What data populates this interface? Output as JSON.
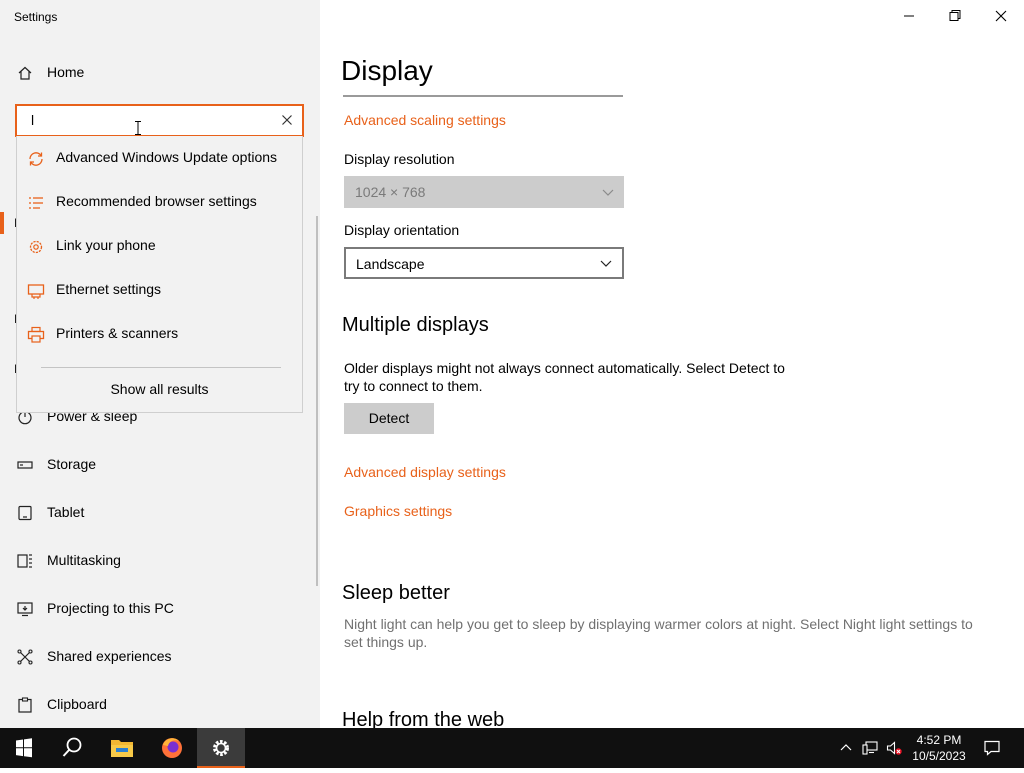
{
  "app": {
    "title": "Settings"
  },
  "sidebar": {
    "home_label": "Home",
    "ghost_letters": [
      "I",
      "I",
      "I"
    ],
    "items": [
      {
        "label": "Power & sleep",
        "icon": "power-icon"
      },
      {
        "label": "Storage",
        "icon": "storage-icon"
      },
      {
        "label": "Tablet",
        "icon": "tablet-icon"
      },
      {
        "label": "Multitasking",
        "icon": "multitasking-icon"
      },
      {
        "label": "Projecting to this PC",
        "icon": "projecting-icon"
      },
      {
        "label": "Shared experiences",
        "icon": "shared-experiences-icon"
      },
      {
        "label": "Clipboard",
        "icon": "clipboard-icon"
      }
    ]
  },
  "search": {
    "value": "l",
    "suggestions": [
      {
        "label": "Advanced Windows Update options",
        "icon": "sync-icon"
      },
      {
        "label": "Recommended browser settings",
        "icon": "list-icon"
      },
      {
        "label": "Link your phone",
        "icon": "gear-icon"
      },
      {
        "label": "Ethernet settings",
        "icon": "ethernet-icon"
      },
      {
        "label": "Printers & scanners",
        "icon": "printer-icon"
      }
    ],
    "show_all": "Show all results"
  },
  "main": {
    "title": "Display",
    "advanced_scaling_link": "Advanced scaling settings",
    "resolution": {
      "label": "Display resolution",
      "value": "1024 × 768",
      "disabled": true
    },
    "orientation": {
      "label": "Display orientation",
      "value": "Landscape"
    },
    "multiple_displays": {
      "heading": "Multiple displays",
      "description": "Older displays might not always connect automatically. Select Detect to try to connect to them.",
      "detect_button": "Detect"
    },
    "advanced_display_link": "Advanced display settings",
    "graphics_link": "Graphics settings",
    "sleep_better": {
      "heading": "Sleep better",
      "description": "Night light can help you get to sleep by displaying warmer colors at night. Select Night light settings to set things up."
    },
    "help_heading": "Help from the web"
  },
  "taskbar": {
    "time": "4:52 PM",
    "date": "10/5/2023",
    "apps": [
      "start-icon",
      "search-icon",
      "file-explorer-icon",
      "firefox-icon",
      "settings-icon"
    ],
    "tray": [
      "chevron-up-icon",
      "network-icon",
      "volume-muted-icon",
      "notification-icon"
    ]
  },
  "colors": {
    "accent": "#e8611a",
    "sidebar_bg": "#f2f2f2",
    "taskbar_bg": "#101010"
  }
}
